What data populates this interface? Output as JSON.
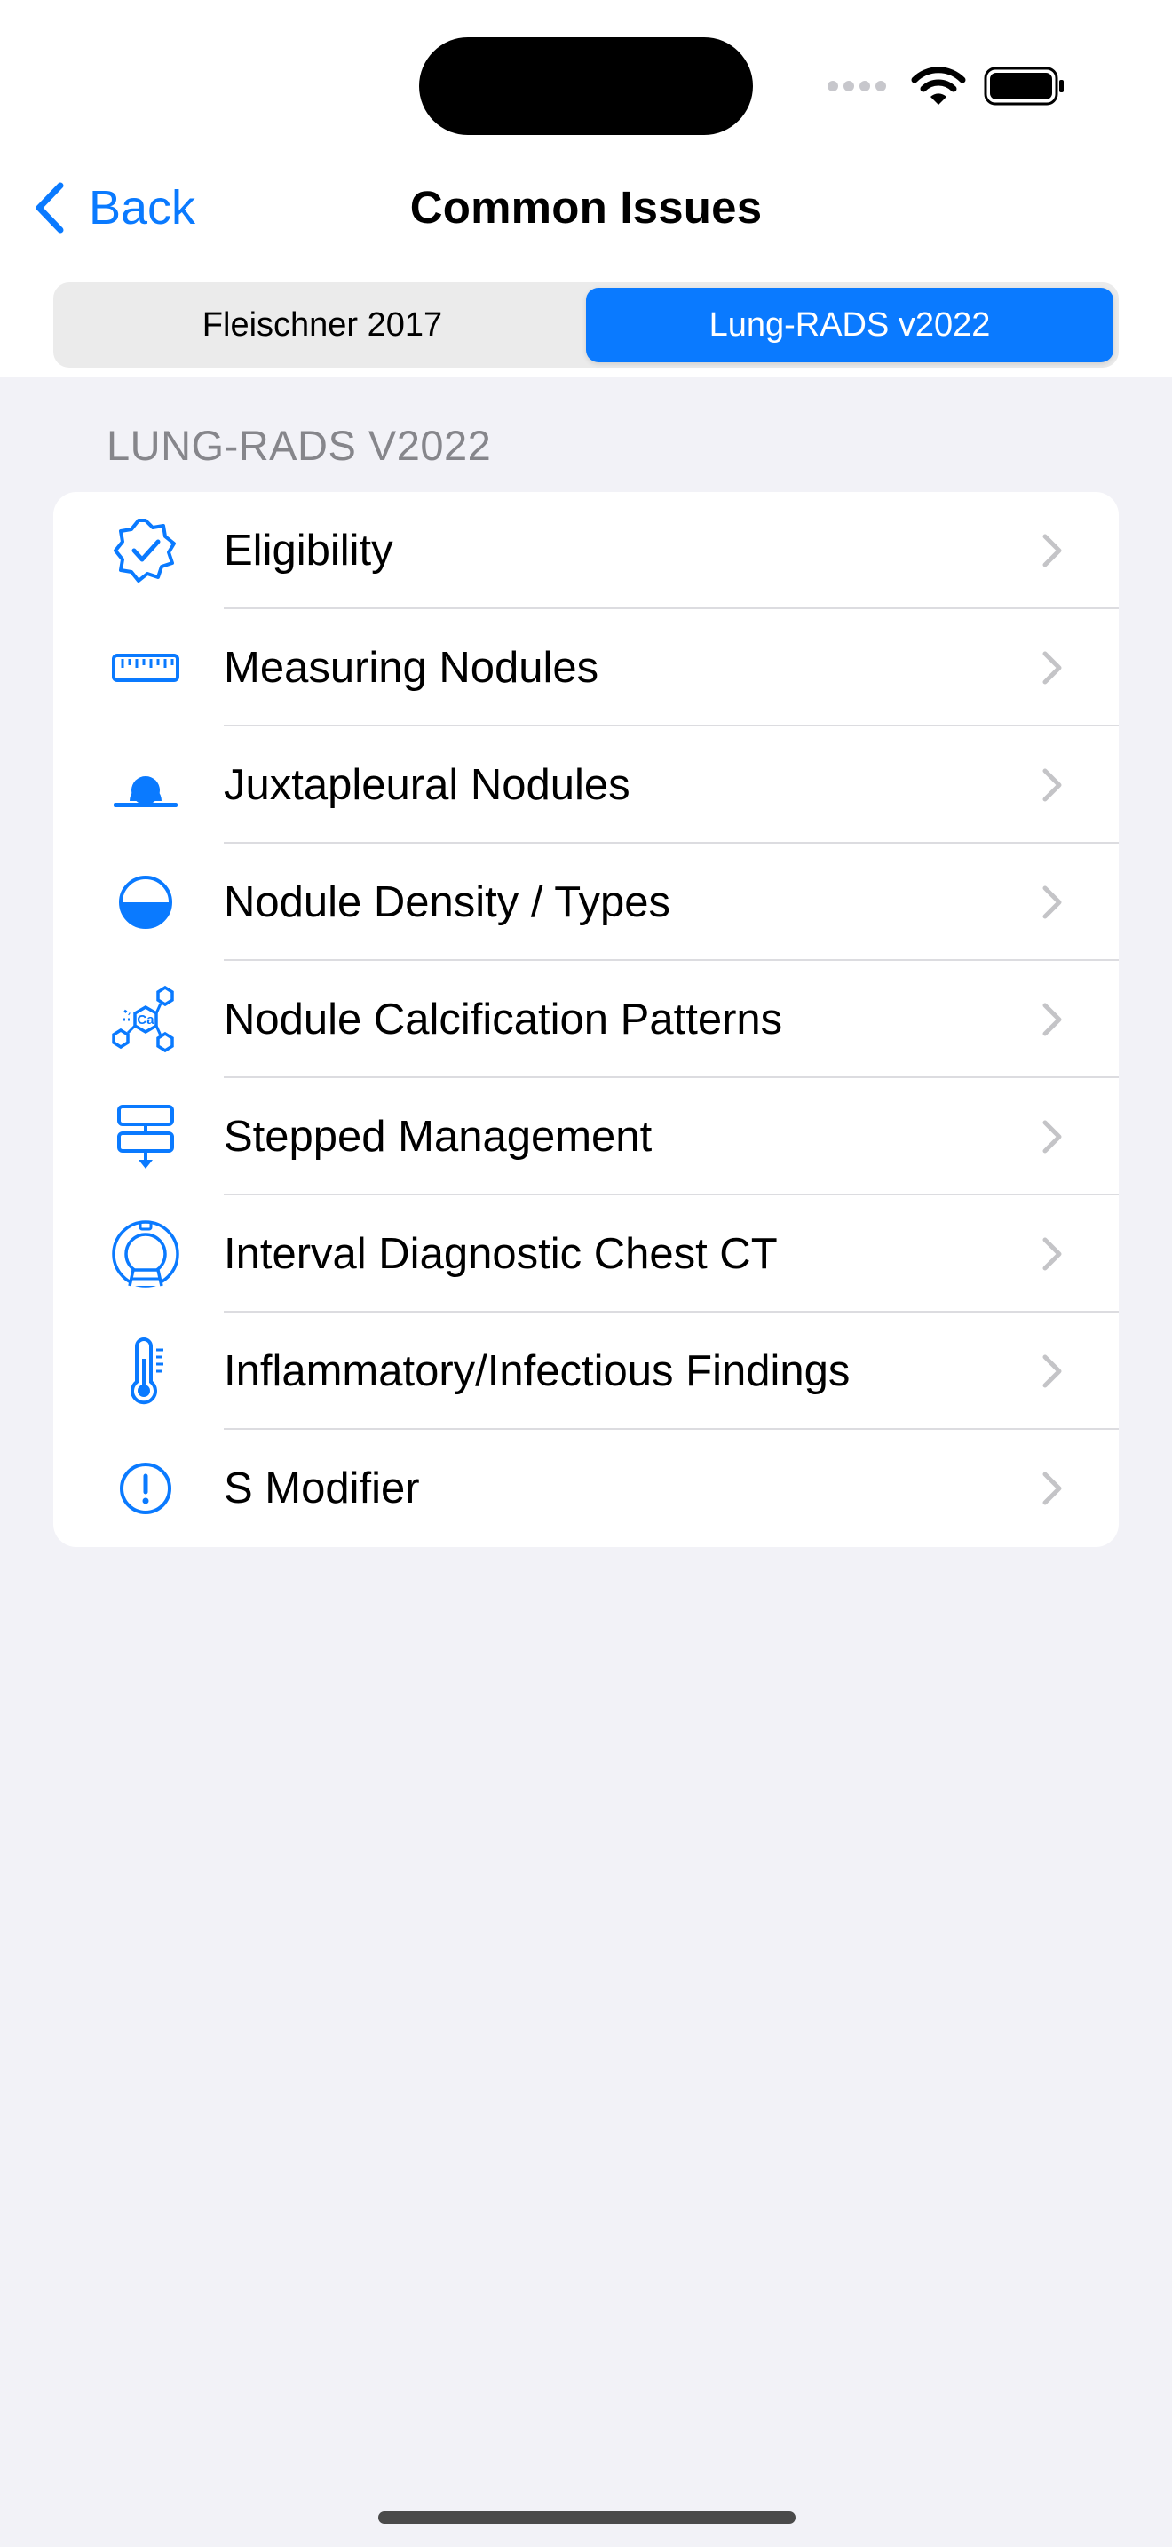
{
  "nav": {
    "back_label": "Back",
    "title": "Common Issues"
  },
  "segments": [
    {
      "label": "Fleischner 2017",
      "selected": false
    },
    {
      "label": "Lung-RADS v2022",
      "selected": true
    }
  ],
  "section": {
    "header": "LUNG-RADS V2022",
    "items": [
      {
        "label": "Eligibility",
        "icon": "verified-badge-icon"
      },
      {
        "label": "Measuring Nodules",
        "icon": "ruler-icon"
      },
      {
        "label": "Juxtapleural Nodules",
        "icon": "juxtapleural-nodule-icon"
      },
      {
        "label": "Nodule Density / Types",
        "icon": "half-filled-circle-icon"
      },
      {
        "label": "Nodule Calcification Patterns",
        "icon": "calcium-molecule-icon"
      },
      {
        "label": "Stepped Management",
        "icon": "stepped-flow-icon"
      },
      {
        "label": "Interval Diagnostic Chest CT",
        "icon": "ct-scanner-icon"
      },
      {
        "label": "Inflammatory/Infectious Findings",
        "icon": "thermometer-icon"
      },
      {
        "label": "S Modifier",
        "icon": "exclamation-circle-icon"
      }
    ]
  },
  "colors": {
    "accent": "#0a7aff",
    "background": "#f2f2f7",
    "card": "#ffffff",
    "section_header": "#86868b",
    "chevron": "#c4c4c7"
  }
}
